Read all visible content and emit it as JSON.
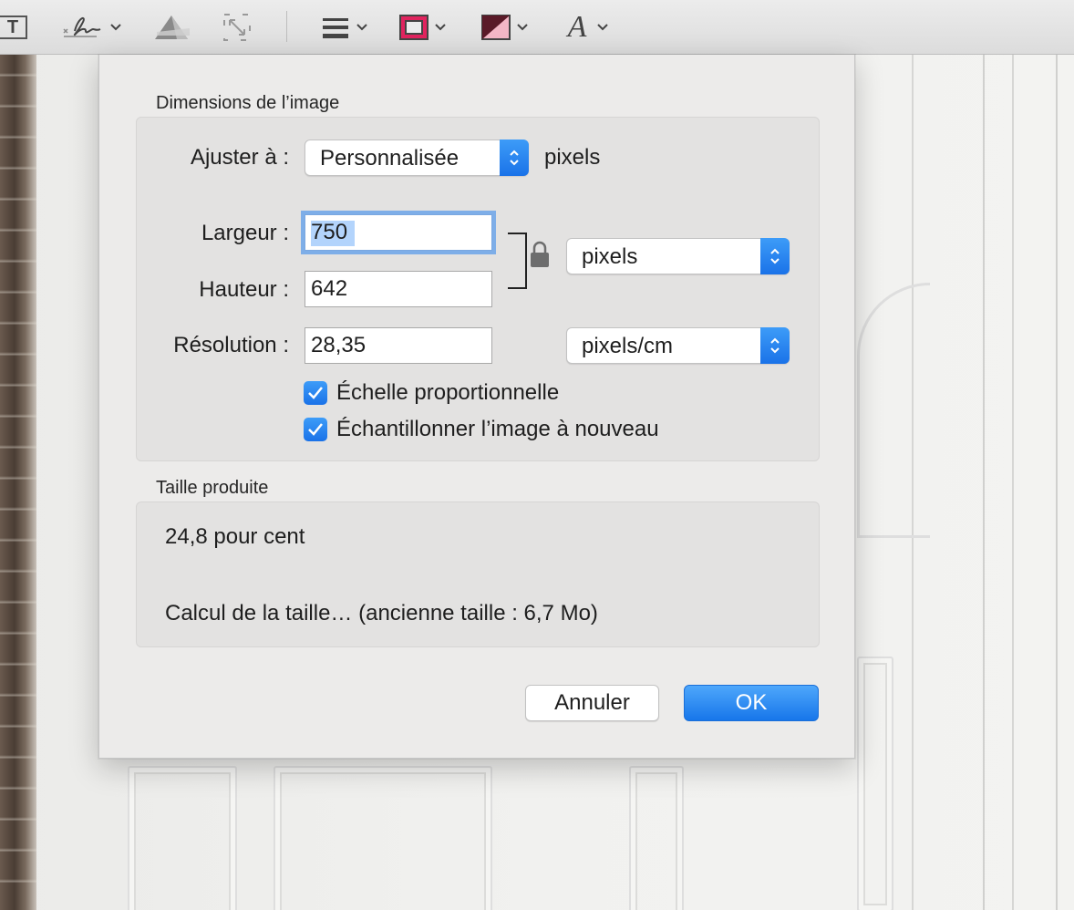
{
  "toolbar": {
    "text_tool": "T",
    "items": [
      {
        "icon": "text-box-icon"
      },
      {
        "icon": "signature-icon"
      },
      {
        "icon": "adjust-color-icon"
      },
      {
        "icon": "resize-icon"
      },
      {
        "icon": "line-style-icon"
      },
      {
        "icon": "border-color-icon",
        "color": "#e0245e"
      },
      {
        "icon": "fill-color-icon",
        "color": "#5a1a28"
      },
      {
        "icon": "text-style-icon"
      }
    ],
    "font_glyph": "A"
  },
  "dialog": {
    "dimensions_title": "Dimensions de l’image",
    "fit_label": "Ajuster à :",
    "fit_value": "Personnalisée",
    "fit_unit": "pixels",
    "width_label": "Largeur :",
    "width_value": "750",
    "height_label": "Hauteur :",
    "height_value": "642",
    "size_unit_value": "pixels",
    "resolution_label": "Résolution :",
    "resolution_value": "28,35",
    "resolution_unit_value": "pixels/cm",
    "scale_proportional_label": "Échelle proportionnelle",
    "scale_proportional_checked": true,
    "resample_label": "Échantillonner l’image à nouveau",
    "resample_checked": true,
    "result_title": "Taille produite",
    "result_percent": "24,8 pour cent",
    "result_size": "Calcul de la taille… (ancienne taille : 6,7 Mo)",
    "cancel_label": "Annuler",
    "ok_label": "OK"
  },
  "colors": {
    "accent": "#1a72e8",
    "border_swatch": "#e0245e",
    "fill_swatch": "#5a1a28"
  }
}
